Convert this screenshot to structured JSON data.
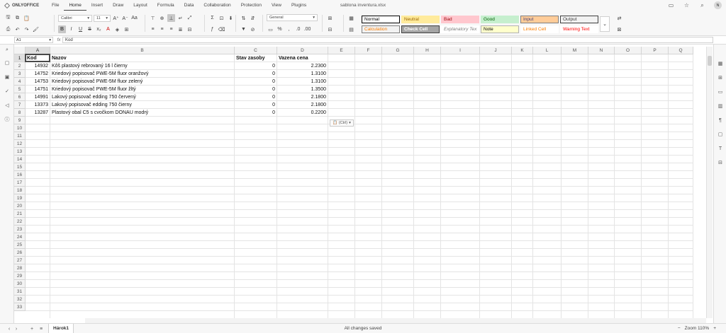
{
  "app": {
    "name": "ONLYOFFICE",
    "document_title": "sablona inventura.xlsx"
  },
  "menu": [
    "File",
    "Home",
    "Insert",
    "Draw",
    "Layout",
    "Formula",
    "Data",
    "Collaboration",
    "Protection",
    "View",
    "Plugins"
  ],
  "menu_active": "Home",
  "user_initial": "N",
  "ribbon": {
    "font_name": "Calibri",
    "font_size": "11",
    "number_format": "General",
    "bold_pressed": true,
    "styles": [
      {
        "label": "Normal",
        "bg": "#ffffff",
        "color": "#000000",
        "border": "#000000"
      },
      {
        "label": "Neutral",
        "bg": "#ffeb9c",
        "color": "#9c6500",
        "border": "#ffeb9c"
      },
      {
        "label": "Bad",
        "bg": "#ffc7ce",
        "color": "#9c0006",
        "border": "#ffc7ce"
      },
      {
        "label": "Good",
        "bg": "#c6efce",
        "color": "#006100",
        "border": "#c6efce"
      },
      {
        "label": "Input",
        "bg": "#ffcc99",
        "color": "#3f3f76",
        "border": "#7f7f7f"
      },
      {
        "label": "Output",
        "bg": "#f2f2f2",
        "color": "#3f3f3f",
        "border": "#3f3f3f"
      },
      {
        "label": "Calculation",
        "bg": "#f2f2f2",
        "color": "#fa7d00",
        "border": "#7f7f7f"
      },
      {
        "label": "Check Cell",
        "bg": "#a5a5a5",
        "color": "#ffffff",
        "border": "#3f3f3f"
      },
      {
        "label": "Explanatory Tex",
        "bg": "#ffffff",
        "color": "#7f7f7f",
        "border": "#ffffff"
      },
      {
        "label": "Note",
        "bg": "#ffffcc",
        "color": "#000000",
        "border": "#b2b2b2"
      },
      {
        "label": "Linked Cell",
        "bg": "#ffffff",
        "color": "#fa7d00",
        "border": "#ffffff"
      },
      {
        "label": "Warning Text",
        "bg": "#ffffff",
        "color": "#ff0000",
        "border": "#ffffff"
      }
    ]
  },
  "formula_bar": {
    "cell_ref": "A1",
    "fx": "fx",
    "value": "Kod"
  },
  "columns": [
    "A",
    "B",
    "C",
    "D",
    "E",
    "F",
    "G",
    "H",
    "I",
    "J",
    "K",
    "L",
    "M",
    "N",
    "O",
    "P",
    "Q"
  ],
  "rows": [
    "1",
    "2",
    "3",
    "4",
    "5",
    "6",
    "7",
    "8",
    "9",
    "10",
    "11",
    "12",
    "13",
    "14",
    "15",
    "16",
    "17",
    "18",
    "19",
    "20",
    "21",
    "22",
    "23",
    "24",
    "25",
    "26",
    "27",
    "28",
    "29",
    "30",
    "31",
    "32",
    "33"
  ],
  "sheet": {
    "header": [
      "Kod",
      "Nazov",
      "Stav zasoby",
      "Vazena cena"
    ],
    "data": [
      [
        "14932",
        "Kôš plastový rebrovaný 16 l čierny",
        "0",
        "2.2300"
      ],
      [
        "14752",
        "Kriedový popisovač PWE-5M fluor oranžový",
        "0",
        "1.3100"
      ],
      [
        "14753",
        "Kriedový popisovač PWE-5M fluor zelený",
        "0",
        "1.3100"
      ],
      [
        "14751",
        "Kriedový popisovač PWE-5M fluor žltý",
        "0",
        "1.3500"
      ],
      [
        "14991",
        "Lakový popisovač edding 750 červený",
        "0",
        "2.1800"
      ],
      [
        "13373",
        "Lakový popisovač edding 750 čierny",
        "0",
        "2.1800"
      ],
      [
        "13287",
        "Plastový obal C5 s cvočkom DONAU modrý",
        "0",
        "0.2200"
      ]
    ]
  },
  "paste_chip": "(Ctrl)",
  "status": {
    "sheet_tab": "Hárok1",
    "save_status": "All changes saved",
    "zoom": "Zoom 110%"
  }
}
